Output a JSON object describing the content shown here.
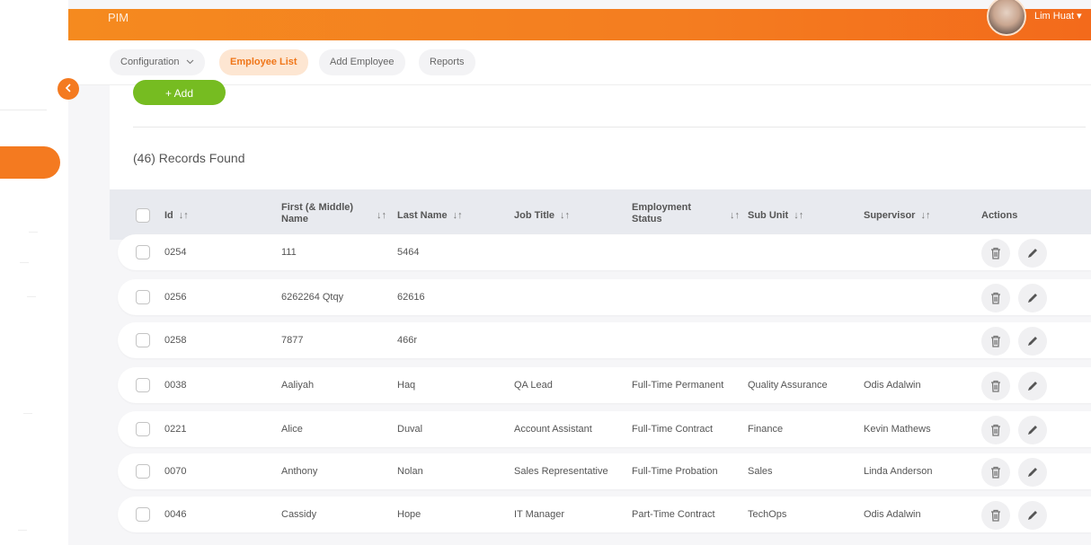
{
  "topbar": {
    "title": "PIM",
    "user_name": "Lim Huat"
  },
  "nav": {
    "tabs": [
      {
        "label": "Configuration"
      },
      {
        "label": "Employee List"
      },
      {
        "label": "Add Employee"
      },
      {
        "label": "Reports"
      }
    ]
  },
  "toolbar": {
    "add_label": "+ Add"
  },
  "records_label": "(46) Records Found",
  "table": {
    "headers": {
      "id": "Id",
      "first_name_line1": "First (& Middle)",
      "first_name_line2": "Name",
      "last_name": "Last Name",
      "job_title": "Job Title",
      "status_line1": "Employment",
      "status_line2": "Status",
      "sub_unit": "Sub Unit",
      "supervisor": "Supervisor",
      "actions": "Actions"
    },
    "rows": [
      {
        "id": "0254",
        "first": "111",
        "last": "5464",
        "job": "",
        "status": "",
        "unit": "",
        "supervisor": ""
      },
      {
        "id": "0256",
        "first": "6262264 Qtqy",
        "last": "62616",
        "job": "",
        "status": "",
        "unit": "",
        "supervisor": ""
      },
      {
        "id": "0258",
        "first": "7877",
        "last": "466r",
        "job": "",
        "status": "",
        "unit": "",
        "supervisor": ""
      },
      {
        "id": "0038",
        "first": "Aaliyah",
        "last": "Haq",
        "job": "QA Lead",
        "status": "Full-Time Permanent",
        "unit": "Quality Assurance",
        "supervisor": "Odis Adalwin"
      },
      {
        "id": "0221",
        "first": "Alice",
        "last": "Duval",
        "job": "Account Assistant",
        "status": "Full-Time Contract",
        "unit": "Finance",
        "supervisor": "Kevin Mathews"
      },
      {
        "id": "0070",
        "first": "Anthony",
        "last": "Nolan",
        "job": "Sales Representative",
        "status": "Full-Time Probation",
        "unit": "Sales",
        "supervisor": "Linda Anderson"
      },
      {
        "id": "0046",
        "first": "Cassidy",
        "last": "Hope",
        "job": "IT Manager",
        "status": "Part-Time Contract",
        "unit": "TechOps",
        "supervisor": "Odis Adalwin"
      }
    ]
  },
  "colors": {
    "accent": "#f47a20",
    "add_green": "#76bc21"
  },
  "icons": {
    "sort": "sort-arrows-icon",
    "delete": "trash-icon",
    "edit": "pencil-icon",
    "collapse": "chevron-left-icon",
    "dropdown": "chevron-down-icon"
  }
}
